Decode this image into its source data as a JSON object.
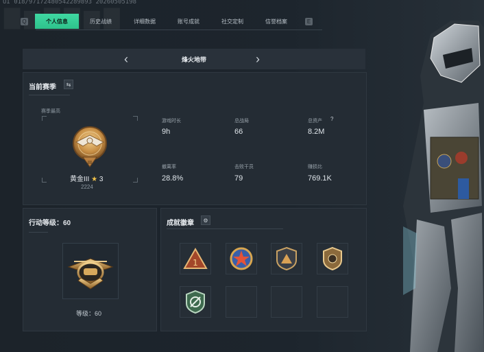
{
  "header": {
    "watermark": "UI 018/97172480542289893 20260505198"
  },
  "tabs": [
    {
      "label": "个人信息",
      "active": true
    },
    {
      "label": "历史战绩",
      "active": false
    },
    {
      "label": "详细数据",
      "active": false
    },
    {
      "label": "账号成就",
      "active": false
    },
    {
      "label": "社交定制",
      "active": false
    },
    {
      "label": "信誉档案",
      "active": false
    }
  ],
  "tab_nav": {
    "left_key": "Q",
    "right_key": "E"
  },
  "map_selector": {
    "prev": "‹",
    "name": "烽火地带",
    "next": "›"
  },
  "season": {
    "title": "当前赛季",
    "peak_label": "赛季最高",
    "rank_name": "黄金III",
    "rank_star": "★",
    "rank_star_count": "3",
    "rank_points": "2224",
    "rank_emblem_numeral": "III",
    "stats": [
      {
        "label": "游戏时长",
        "value": "9h"
      },
      {
        "label": "总战局",
        "value": "66"
      },
      {
        "label": "总资产",
        "value": "8.2M"
      },
      {
        "label": "撤离率",
        "value": "28.8%"
      },
      {
        "label": "击败干员",
        "value": "79"
      },
      {
        "label": "赚损比",
        "value": "769.1K"
      }
    ],
    "help_icon": "?"
  },
  "action_level": {
    "title": "行动等级：60",
    "level_label": "等级：60"
  },
  "achievements": {
    "title": "成就徽章",
    "badges": [
      {
        "name": "badge-1",
        "glyph": "1"
      },
      {
        "name": "badge-2",
        "glyph": ""
      },
      {
        "name": "badge-3",
        "glyph": ""
      },
      {
        "name": "badge-4",
        "glyph": ""
      },
      {
        "name": "badge-5",
        "glyph": ""
      }
    ]
  },
  "colors": {
    "accent": "#33c993",
    "gold": "#c8924a",
    "panel": "#242c34"
  }
}
